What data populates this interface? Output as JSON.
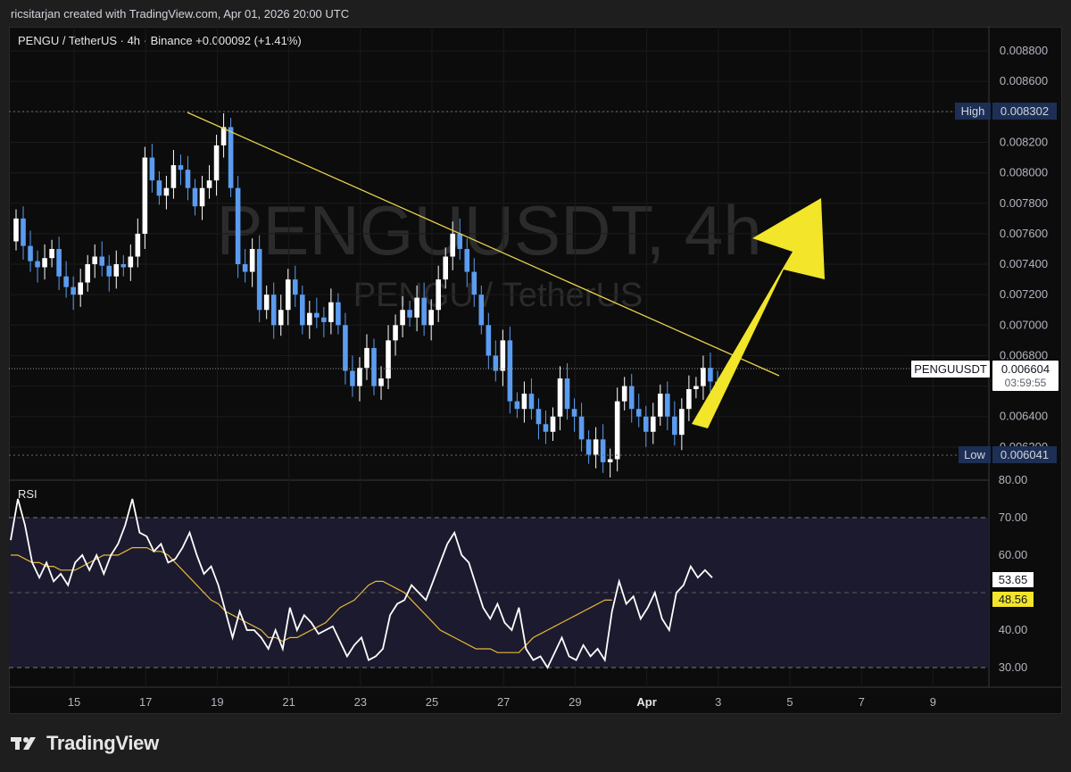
{
  "header": {
    "creator_line": "ricsitarjan created with TradingView.com, Apr 01, 2026 20:00 UTC"
  },
  "legend": {
    "symbol_line": "PENGU / TetherUS · 4h · Binance  +0.000092 (+1.41%)"
  },
  "watermark": {
    "main": "PENGUUSDT, 4h",
    "sub": "PENGU / TetherUS"
  },
  "price_scale": {
    "ticks": [
      "0.008800",
      "0.008600",
      "0.008400",
      "0.008200",
      "0.008000",
      "0.007800",
      "0.007600",
      "0.007400",
      "0.007200",
      "0.007000",
      "0.006800",
      "0.006600",
      "0.006400",
      "0.006200"
    ],
    "high_label": "High",
    "high_value": "0.008302",
    "low_label": "Low",
    "low_value": "0.006041",
    "current_symbol": "PENGUUSDT",
    "current_value": "0.006604",
    "countdown": "03:59:55"
  },
  "rsi_panel": {
    "title": "RSI",
    "ticks": [
      "80.00",
      "70.00",
      "60.00",
      "40.00",
      "30.00"
    ],
    "rsi_value": "53.65",
    "ma_value": "48.56"
  },
  "time_axis": {
    "labels": [
      "15",
      "17",
      "19",
      "21",
      "23",
      "25",
      "27",
      "29",
      "Apr",
      "3",
      "5",
      "7",
      "9"
    ]
  },
  "footer": {
    "brand": "TradingView"
  },
  "colors": {
    "up_candle": "#ffffff",
    "down_candle": "#5b9cf0",
    "trendline": "#e8d44d",
    "arrow": "#f2e52a",
    "rsi_line": "#ffffff",
    "rsi_ma": "#e8b83a",
    "rsi_band": "#1c1a2e"
  },
  "chart_data": [
    {
      "type": "candlestick",
      "title": "PENGU / TetherUS · 4h · Binance",
      "x_labels": [
        "15",
        "17",
        "19",
        "21",
        "23",
        "25",
        "27",
        "29",
        "Apr",
        "3",
        "5",
        "7",
        "9"
      ],
      "ylim": [
        0.006,
        0.0089
      ],
      "high": 0.008302,
      "low": 0.006041,
      "last": 0.006604,
      "closes": [
        0.0077,
        0.00752,
        0.00742,
        0.00738,
        0.00744,
        0.0075,
        0.00732,
        0.00725,
        0.0072,
        0.00728,
        0.0074,
        0.00745,
        0.00739,
        0.00732,
        0.0074,
        0.00738,
        0.00745,
        0.0076,
        0.0081,
        0.00795,
        0.00785,
        0.0079,
        0.00805,
        0.00802,
        0.0079,
        0.00778,
        0.0079,
        0.00795,
        0.00818,
        0.0083,
        0.0079,
        0.0074,
        0.00735,
        0.0075,
        0.0071,
        0.0072,
        0.007,
        0.0071,
        0.0073,
        0.0072,
        0.007,
        0.00708,
        0.00705,
        0.00702,
        0.00715,
        0.007,
        0.0067,
        0.0066,
        0.00672,
        0.00685,
        0.0066,
        0.00665,
        0.0069,
        0.007,
        0.0071,
        0.00705,
        0.00718,
        0.007,
        0.0071,
        0.0073,
        0.00745,
        0.0076,
        0.0075,
        0.00735,
        0.0072,
        0.007,
        0.0068,
        0.0067,
        0.0069,
        0.0065,
        0.00645,
        0.00655,
        0.00645,
        0.00635,
        0.0063,
        0.0064,
        0.00665,
        0.00645,
        0.0064,
        0.00625,
        0.00615,
        0.00625,
        0.0061,
        0.00612,
        0.0065,
        0.0066,
        0.00645,
        0.0064,
        0.0063,
        0.0064,
        0.00655,
        0.0064,
        0.00628,
        0.00645,
        0.00658,
        0.0066,
        0.00672,
        0.00663,
        0.0066
      ]
    },
    {
      "type": "line",
      "title": "RSI",
      "ylim": [
        27,
        82
      ],
      "series": [
        {
          "name": "RSI",
          "values": [
            64,
            75,
            68,
            58,
            54,
            58,
            53,
            55,
            52,
            58,
            60,
            56,
            60,
            55,
            60,
            63,
            68,
            75,
            66,
            65,
            61,
            63,
            58,
            59,
            62,
            66,
            60,
            55,
            57,
            52,
            45,
            38,
            45,
            40,
            40,
            38,
            35,
            40,
            35,
            46,
            40,
            44,
            42,
            39,
            40,
            41,
            37,
            33,
            36,
            38,
            32,
            33,
            35,
            44,
            47,
            48,
            52,
            50,
            48,
            53,
            58,
            63,
            66,
            60,
            58,
            52,
            46,
            43,
            47,
            42,
            40,
            46,
            35,
            32,
            33,
            30,
            34,
            38,
            33,
            32,
            36,
            33,
            35,
            32,
            45,
            53,
            47,
            49,
            43,
            46,
            50,
            43,
            40,
            50,
            52,
            57,
            54,
            56,
            54
          ]
        },
        {
          "name": "RSI MA",
          "values": [
            60,
            60,
            59,
            58,
            58,
            57,
            57,
            56,
            56,
            56,
            57,
            58,
            59,
            60,
            60,
            60,
            61,
            62,
            62,
            62,
            61,
            61,
            60,
            58,
            56,
            54,
            52,
            50,
            48,
            47,
            45,
            44,
            43,
            42,
            41,
            40,
            38,
            38,
            37,
            38,
            38,
            39,
            40,
            41,
            42,
            44,
            46,
            47,
            48,
            50,
            52,
            53,
            53,
            52,
            51,
            50,
            48,
            46,
            44,
            42,
            40,
            39,
            38,
            37,
            36,
            35,
            35,
            35,
            34,
            34,
            34,
            34,
            36,
            38,
            39,
            40,
            41,
            42,
            43,
            44,
            45,
            46,
            47,
            48,
            48
          ]
        }
      ],
      "levels": [
        70,
        50,
        30
      ]
    }
  ]
}
